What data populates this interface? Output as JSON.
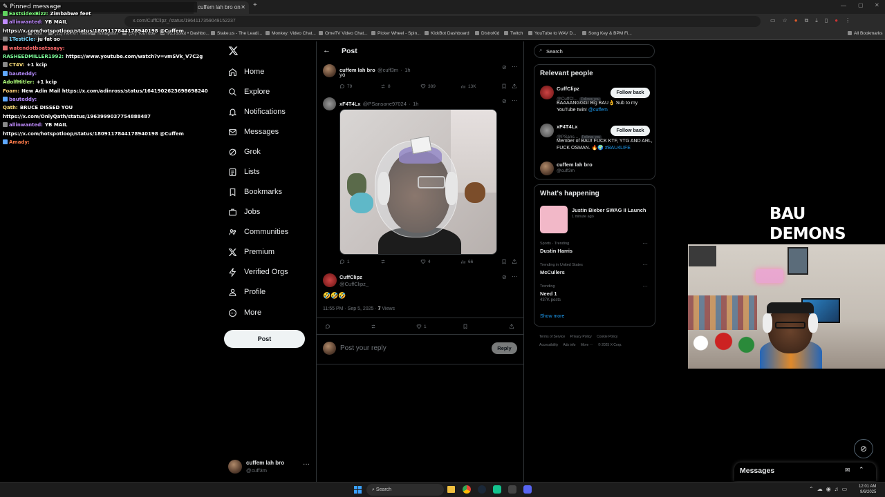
{
  "browser": {
    "tab_title": "cuffem lah bro on X: \"@PSansone97024...",
    "url_fragment": "x.com/CuffClipz_/status/1964117359049152237",
    "bookmarks": [
      {
        "label": "Kick"
      },
      {
        "label": "(12) Home / Twitter"
      },
      {
        "label": "Instagram"
      },
      {
        "label": "(57) YouTube"
      },
      {
        "label": "IRLToolkit • Dashbo..."
      },
      {
        "label": "Stake.us - The Leadi..."
      },
      {
        "label": "Monkey: Video Chat..."
      },
      {
        "label": "OmeTV Video Chat..."
      },
      {
        "label": "Picker Wheel - Spin..."
      },
      {
        "label": "KickBot Dashboard"
      },
      {
        "label": "DistroKid"
      },
      {
        "label": "Twitch"
      },
      {
        "label": "YouTube to WAV D..."
      },
      {
        "label": "Song Key & BPM Fi..."
      }
    ],
    "all_bookmarks": "All Bookmarks"
  },
  "chat": {
    "pinned_title": "Pinned message",
    "lines": [
      {
        "user": "EastsidexBizz:",
        "msg": "Zimbabwe feet",
        "color": "#7dff7d",
        "badge": "#5fd35f"
      },
      {
        "user": "allinwanted:",
        "msg": "YB MAIL",
        "color": "#c08bff",
        "badge": "#c08bff"
      },
      {
        "user": "",
        "msg": "https://x.com/hotspotloop/status/1809117844178940198 @Cuffem",
        "color": "#fff",
        "badge": ""
      },
      {
        "user": "1TestiCle:",
        "msg": "ju fat so",
        "color": "#7fd9ff",
        "badge": "#888"
      },
      {
        "user": "watendotboatsaayy:",
        "msg": "",
        "color": "#ff6b6b",
        "badge": "#e07070"
      },
      {
        "user": "RASHEEDMILLER1992:",
        "msg": "https://www.youtube.com/watch?v=vmSVk_V7C2g",
        "color": "#7dff9b",
        "badge": ""
      },
      {
        "user": "CT4V:",
        "msg": "+1 kcip",
        "color": "#ffe07a",
        "badge": "#888"
      },
      {
        "user": "bauteddy:",
        "msg": "",
        "color": "#b68cff",
        "badge": "#5fa8ff"
      },
      {
        "user": "AdolfHitler:",
        "msg": "+1 kcip",
        "color": "#b0ff7a",
        "badge": ""
      },
      {
        "user": "Foam:",
        "msg": "New Adin Mail https://x.com/adinross/status/1641902623698698240",
        "color": "#ffd27a",
        "badge": ""
      },
      {
        "user": "bauteddy:",
        "msg": "",
        "color": "#b68cff",
        "badge": "#5fa8ff"
      },
      {
        "user": "Qath:",
        "msg": "BRUCE DISSED YOU",
        "color": "#ffe07a",
        "badge": ""
      },
      {
        "user": "",
        "msg": "https://x.com/OnlyQath/status/1963999037754888487",
        "color": "#fff",
        "badge": ""
      },
      {
        "user": "allinwanted:",
        "msg": "YB MAIL",
        "color": "#c08bff",
        "badge": "#888"
      },
      {
        "user": "",
        "msg": "https://x.com/hotspotloop/status/1809117844178940198 @Cuffem",
        "color": "#fff",
        "badge": ""
      },
      {
        "user": "Amady:",
        "msg": "",
        "color": "#ff7b4a",
        "badge": "#5fa8ff"
      }
    ]
  },
  "nav": {
    "items": [
      {
        "label": "Home",
        "icon": "home-icon"
      },
      {
        "label": "Explore",
        "icon": "search-icon"
      },
      {
        "label": "Notifications",
        "icon": "bell-icon"
      },
      {
        "label": "Messages",
        "icon": "envelope-icon"
      },
      {
        "label": "Grok",
        "icon": "grok-icon"
      },
      {
        "label": "Lists",
        "icon": "list-icon"
      },
      {
        "label": "Bookmarks",
        "icon": "bookmark-icon"
      },
      {
        "label": "Jobs",
        "icon": "briefcase-icon"
      },
      {
        "label": "Communities",
        "icon": "people-icon"
      },
      {
        "label": "Premium",
        "icon": "x-logo-icon"
      },
      {
        "label": "Verified Orgs",
        "icon": "lightning-icon"
      },
      {
        "label": "Profile",
        "icon": "person-icon"
      },
      {
        "label": "More",
        "icon": "more-circle-icon"
      }
    ],
    "post_button": "Post",
    "account": {
      "name": "cuffem lah bro",
      "handle": "@cuff3m"
    }
  },
  "thread": {
    "header": "Post",
    "parent": {
      "name": "cuffem lah bro",
      "handle": "@cuff3m",
      "time": "1h",
      "text": "yo",
      "replies": "79",
      "reposts": "8",
      "likes": "389",
      "views": "13K"
    },
    "quoted": {
      "name": "xF4T4Lx",
      "handle": "@PSansone97024",
      "time": "1h",
      "replies": "1",
      "likes": "4",
      "views": "66"
    },
    "main": {
      "name": "CuffClipz",
      "handle": "@CuffClipz_",
      "text": "🤣🤣🤣",
      "timestamp": "11:55 PM · Sep 5, 2025 ·",
      "views_count": "7",
      "views_label": "Views",
      "likes": "1"
    },
    "reply_placeholder": "Post your reply",
    "reply_button": "Reply"
  },
  "sidebar": {
    "search_placeholder": "Search",
    "relevant_title": "Relevant people",
    "people": [
      {
        "name": "CuffClipz",
        "handle": "@CuffCl...",
        "follows_you": "Follows you",
        "button": "Follow back",
        "bio": "BAAAANGGGI Big BAU👌 Sub to my YouTube twin!",
        "bio_link": "@cuffem"
      },
      {
        "name": "xF4T4Lx",
        "handle": "@PSans...",
        "follows_you": "Follows you",
        "button": "Follow back",
        "bio": "Member of BAU! FUCK KTF, YTG AND ARL, FUCK OSMAN. 🔥🌍",
        "bio_link": "#BAU4LIFE"
      },
      {
        "name": "cuffem lah bro",
        "handle": "@cuff3m"
      }
    ],
    "happening_title": "What's happening",
    "featured": {
      "title": "Justin Bieber SWAG II Launch",
      "meta": "1 minute ago"
    },
    "trends": [
      {
        "context": "Sports · Trending",
        "name": "Dustin Harris",
        "posts": ""
      },
      {
        "context": "Trending in United States",
        "name": "McCullers",
        "posts": ""
      },
      {
        "context": "Trending",
        "name": "Need 1",
        "posts": "437K posts"
      }
    ],
    "show_more": "Show more",
    "footer_links": [
      "Terms of Service",
      "Privacy Policy",
      "Cookie Policy",
      "Accessibility",
      "Ads info",
      "More ···",
      "© 2025 X Corp."
    ]
  },
  "overlay": {
    "title": "BAU DEMONS 2013"
  },
  "messages_drawer": {
    "title": "Messages"
  },
  "taskbar": {
    "search_placeholder": "Search",
    "time": "12:01 AM",
    "date": "9/6/2025"
  }
}
